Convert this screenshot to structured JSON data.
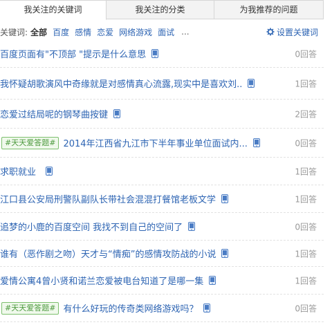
{
  "tabs": [
    {
      "label": "我关注的关键词",
      "active": true
    },
    {
      "label": "我关注的分类",
      "active": false
    },
    {
      "label": "为我推荐的问题",
      "active": false
    }
  ],
  "keywords": {
    "label": "关键词:",
    "items": [
      {
        "label": "全部",
        "active": true
      },
      {
        "label": "百度",
        "active": false
      },
      {
        "label": "感情",
        "active": false
      },
      {
        "label": "恋爱",
        "active": false
      },
      {
        "label": "网络游戏",
        "active": false
      },
      {
        "label": "面试",
        "active": false
      }
    ],
    "more": "...",
    "settings_label": "设置关键词"
  },
  "questions": [
    {
      "text": "百度页面有\"不顶部 \"提示是什么意思",
      "tag": "",
      "answers": "0回答"
    },
    {
      "text": "我怀疑胡歌演风中奇缘就是对感情真心流露,现实中是喜欢刘...",
      "tag": "",
      "answers": "1回答"
    },
    {
      "text": "恋爱过结局呢的钢琴曲按键",
      "tag": "",
      "answers": "2回答"
    },
    {
      "text": "2014年江西省九江市下半年事业单位面试内...",
      "tag": "#天天爱答题#",
      "answers": "0回答"
    },
    {
      "text": "求职就业",
      "tag": "",
      "answers": "1回答"
    },
    {
      "text": "江口县公安局刑警队副队长带社会混混打餐馆老板文学",
      "tag": "",
      "answers": "1回答"
    },
    {
      "text": "追梦的小鹿的百度空间 我找不到自己的空间了",
      "tag": "",
      "answers": "0回答"
    },
    {
      "text": "谁有（恶作剧之吻）天才与“情痴”的感情攻防战的小说",
      "tag": "",
      "answers": "1回答"
    },
    {
      "text": "爱情公寓4曾小贤和诺兰恋爱被电台知道了是哪一集",
      "tag": "",
      "answers": "1回答"
    },
    {
      "text": "有什么好玩的传奇类网络游戏吗？",
      "tag": "#天天爱答题#",
      "answers": "0回答"
    }
  ],
  "colors": {
    "link": "#2d64b3",
    "tag_border": "#7cbf6d",
    "tag_text": "#4d9a3e",
    "muted": "#999999"
  },
  "icons": {
    "settings": "gear-icon",
    "mobile": "mobile-phone-icon"
  }
}
